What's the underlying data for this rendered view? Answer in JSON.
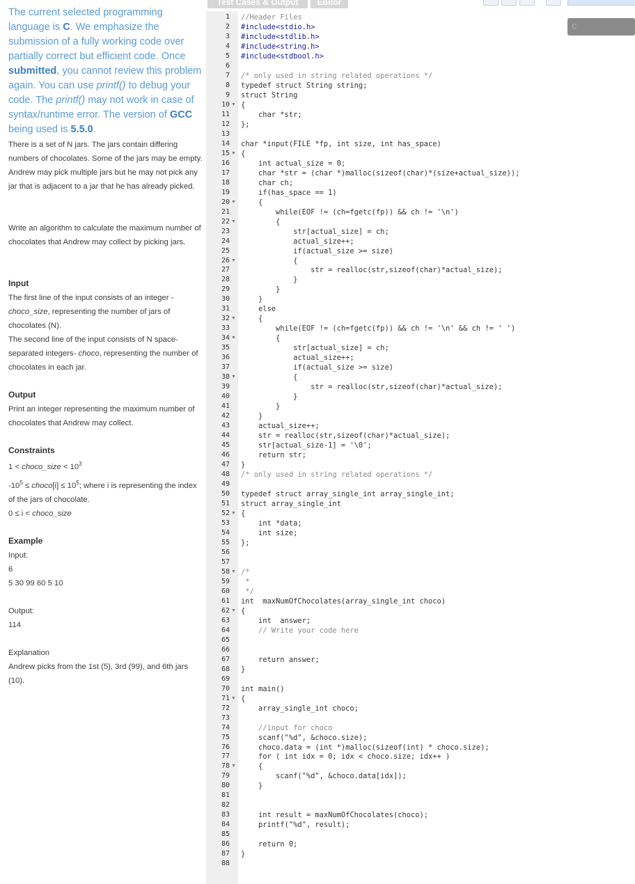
{
  "intro": {
    "p1": "The current selected programming language is ",
    "lang": "C",
    "p2": ". We emphasize the submission of a fully working code over partially correct but efficient code. Once ",
    "submitted": "submitted",
    "p3": ", you cannot review this problem again. You can use ",
    "printf1": "printf()",
    "p4": " to debug your code. The ",
    "printf2": "printf()",
    "p5": " may not work in case of syntax/runtime error. The version of ",
    "gcc": "GCC",
    "p6": " being used is ",
    "ver": "5.5.0",
    "p7": "."
  },
  "problem": {
    "desc": "There is a set of N jars. The jars contain differing numbers of chocolates. Some of the jars may be empty. Andrew may pick multiple jars but he may not pick any jar that is adjacent to a jar that he has already picked.",
    "task": "Write an algorithm to calculate the maximum number of chocolates that Andrew may collect by picking jars.",
    "input_heading": "Input",
    "input_1a": "The first line of the input consists of an integer - ",
    "input_1b": "choco_size",
    "input_1c": ", representing the number of jars of chocolates (N).",
    "input_2a": "The second line of the input consists of N space-separated integers- ",
    "input_2b": "choco",
    "input_2c": ", representing the number of chocolates in each jar.",
    "output_heading": "Output",
    "output_text": "Print an integer representing the maximum number of chocolates that Andrew may collect.",
    "constraints_heading": "Constraints",
    "c1a": "1 < ",
    "c1b": "choco_size",
    "c1c": " < 10",
    "c1d": "3",
    "c2a": "-10",
    "c2b": "5",
    "c2c": " ≤ ",
    "c2d": "choco",
    "c2e": "[i] ≤ 10",
    "c2f": "5",
    "c2g": "; where i is representing the index of the jars of chocolate.",
    "c3a": "0 ≤ i < ",
    "c3b": "choco_size",
    "example_heading": "Example",
    "input_label": "Input:",
    "input_n": "6",
    "input_vals": "5 30 99 60 5 10",
    "output_label": "Output:",
    "output_val": "114",
    "explanation_label": "Explanation",
    "explanation_text": "Andrew picks from the 1st (5), 3rd (99), and 6th jars (10)."
  },
  "editor": {
    "tab_tests": "Test Cases & Output",
    "tab_editor": "Editor",
    "language": "C",
    "fold_lines": [
      10,
      15,
      20,
      22,
      26,
      32,
      34,
      38,
      52,
      58,
      62,
      71,
      78
    ],
    "lines": [
      "//Header Files",
      "#include<stdio.h>",
      "#include<stdlib.h>",
      "#include<string.h>",
      "#include<stdbool.h>",
      "",
      "/* only used in string related operations */",
      "typedef struct String string;",
      "struct String",
      "{",
      "    char *str;",
      "};",
      "",
      "char *input(FILE *fp, int size, int has_space)",
      "{",
      "    int actual_size = 0;",
      "    char *str = (char *)malloc(sizeof(char)*(size+actual_size));",
      "    char ch;",
      "    if(has_space == 1)",
      "    {",
      "        while(EOF != (ch=fgetc(fp)) && ch != '\\n')",
      "        {",
      "            str[actual_size] = ch;",
      "            actual_size++;",
      "            if(actual_size >= size)",
      "            {",
      "                str = realloc(str,sizeof(char)*actual_size);",
      "            }",
      "        }",
      "    }",
      "    else",
      "    {",
      "        while(EOF != (ch=fgetc(fp)) && ch != '\\n' && ch != ' ')",
      "        {",
      "            str[actual_size] = ch;",
      "            actual_size++;",
      "            if(actual_size >= size)",
      "            {",
      "                str = realloc(str,sizeof(char)*actual_size);",
      "            }",
      "        }",
      "    }",
      "    actual_size++;",
      "    str = realloc(str,sizeof(char)*actual_size);",
      "    str[actual_size-1] = '\\0';",
      "    return str;",
      "}",
      "/* only used in string related operations */",
      "",
      "typedef struct array_single_int array_single_int;",
      "struct array_single_int",
      "{",
      "    int *data;",
      "    int size;",
      "};",
      "",
      "",
      "/*",
      " *",
      " */",
      "int  maxNumOfChocolates(array_single_int choco)",
      "{",
      "    int  answer;",
      "    // Write your code here",
      "",
      "",
      "    return answer;",
      "}",
      "",
      "int main()",
      "{",
      "    array_single_int choco;",
      "",
      "    //input for choco",
      "    scanf(\"%d\", &choco.size);",
      "    choco.data = (int *)malloc(sizeof(int) * choco.size);",
      "    for ( int idx = 0; idx < choco.size; idx++ )",
      "    {",
      "        scanf(\"%d\", &choco.data[idx]);",
      "    }",
      "",
      "",
      "    int result = maxNumOfChocolates(choco);",
      "    printf(\"%d\", result);",
      "",
      "    return 0;",
      "}",
      ""
    ]
  }
}
